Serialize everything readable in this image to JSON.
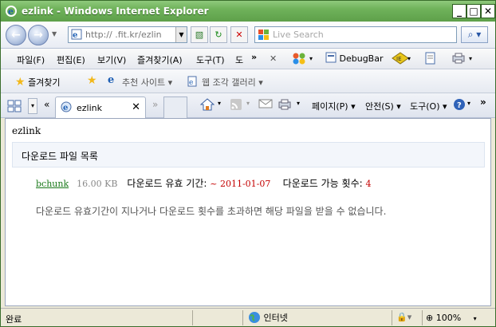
{
  "window": {
    "title": "ezlink - Windows Internet Explorer"
  },
  "address": {
    "url": "http://      .fit.kr/ezlin",
    "search_placeholder": "Live Search"
  },
  "menu": {
    "items": [
      "파일(F)",
      "편집(E)",
      "보기(V)",
      "즐겨찾기(A)",
      "도구(T)",
      "도"
    ],
    "more": "»",
    "debugbar": "DebugBar"
  },
  "favorites": {
    "label": "즐겨찾기",
    "suggested": "추천 사이트 ▾",
    "gallery": "웹 조각 갤러리 ▾"
  },
  "tab": {
    "label": "ezlink"
  },
  "commands": {
    "page": "페이지(P) ▾",
    "safety": "안전(S) ▾",
    "tools": "도구(O) ▾"
  },
  "page": {
    "title": "ezlink",
    "section_title": "다운로드 파일 목록",
    "file": {
      "name": "bchunk",
      "size": "16.00 KB",
      "expiry_label": "다운로드 유효 기간:",
      "expiry_value": "~ 2011-01-07",
      "count_label": "다운로드 가능 횟수:",
      "count_value": "4"
    },
    "notice": "다운로드 유효기간이 지나거나 다운로드 횟수를 초과하면 해당 파일을 받을 수 없습니다."
  },
  "status": {
    "text": "완료",
    "zone": "인터넷",
    "zoom": "100%"
  }
}
